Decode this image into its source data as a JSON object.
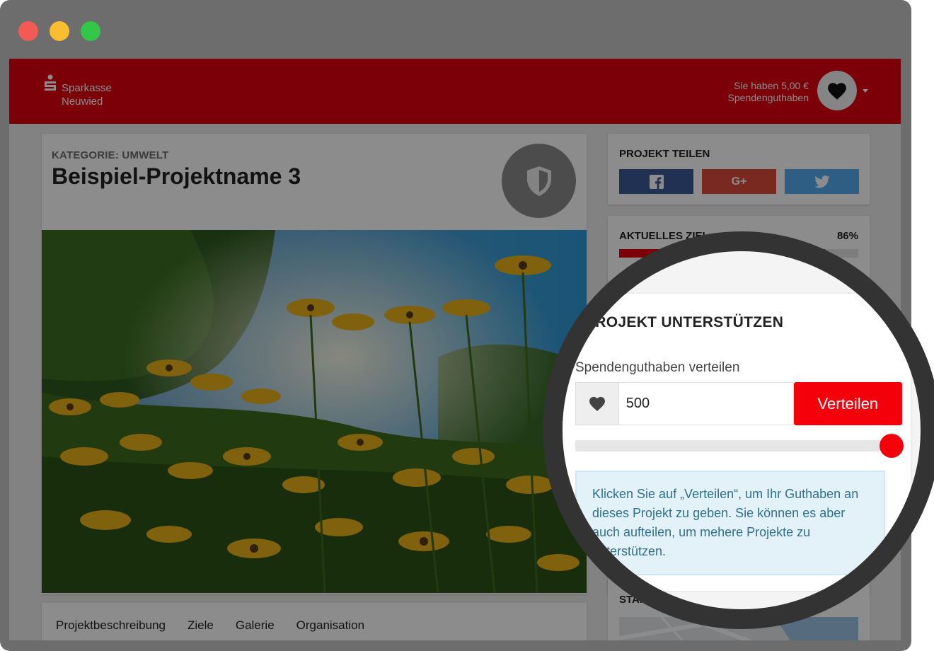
{
  "window": {
    "controls": [
      "close",
      "minimize",
      "maximize"
    ]
  },
  "header": {
    "brand_line1": "Sparkasse",
    "brand_line2": "Neuwied",
    "credit_line1": "Sie haben 5,00 €",
    "credit_line2": "Spendenguthaben",
    "account_icon": "heart-icon",
    "brand_color": "#e0000f"
  },
  "project": {
    "category": "KATEGORIE: UMWELT",
    "title": "Beispiel-Projektname 3",
    "badge_icon": "shield-icon",
    "tabs": [
      "Projektbeschreibung",
      "Ziele",
      "Galerie",
      "Organisation"
    ]
  },
  "sidebar": {
    "share_heading": "PROJEKT TEILEN",
    "share_buttons": [
      {
        "icon": "facebook-icon",
        "color": "#3b5998"
      },
      {
        "label": "G+",
        "icon": "google-plus-icon",
        "color": "#dd4b39"
      },
      {
        "icon": "twitter-icon",
        "color": "#55acee"
      }
    ],
    "goal_heading": "AKTUELLES ZIEL",
    "goal_percent_label": "86%",
    "goal_fraction": 0.86,
    "location_heading": "STANDORT"
  },
  "support": {
    "heading": "PROJEKT UNTERSTÜTZEN",
    "distribute_label": "Spendenguthaben verteilen",
    "amount_value": "500",
    "distribute_button": "Verteilen",
    "slider_fraction": 1.0,
    "info_text": "Klicken Sie auf „Verteilen“, um Ihr Guthaben an dieses Projekt zu geben. Sie können es aber auch aufteilen, um mehere Projekte zu unterstützen."
  }
}
